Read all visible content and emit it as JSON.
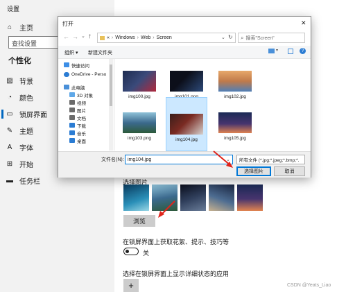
{
  "settings": {
    "window_title": "设置",
    "home_label": "主页",
    "search_placeholder": "查找设置",
    "section_title": "个性化",
    "nav": [
      {
        "label": "背景",
        "icon": "picture-icon"
      },
      {
        "label": "颜色",
        "icon": "palette-icon"
      },
      {
        "label": "锁屏界面",
        "icon": "lockscreen-icon",
        "active": true
      },
      {
        "label": "主题",
        "icon": "theme-icon"
      },
      {
        "label": "字体",
        "icon": "font-icon"
      },
      {
        "label": "开始",
        "icon": "start-icon"
      },
      {
        "label": "任务栏",
        "icon": "taskbar-icon"
      }
    ],
    "choose_picture_label": "选择图片",
    "browse_button": "浏览",
    "tips_label": "在锁屏界面上获取花絮、提示、技巧等",
    "toggle_state": "关",
    "detail_app_label": "选择在锁屏界面上显示详细状态的应用",
    "add_symbol": "+"
  },
  "dialog": {
    "title": "打开",
    "breadcrumb": [
      "«",
      "Windows",
      "Web",
      "Screen"
    ],
    "search_placeholder": "搜索\"Screen\"",
    "organize_label": "组织 ▾",
    "new_folder_label": "新建文件夹",
    "tree": [
      {
        "label": "快速访问",
        "color": "#3d8ee6"
      },
      {
        "label": "OneDrive - Perso",
        "color": "#2b7cd3"
      },
      {
        "label": "此电脑",
        "color": "#4a90d9"
      },
      {
        "label": "3D 对象",
        "color": "#5fa8e8"
      },
      {
        "label": "视频",
        "color": "#6b6b6b"
      },
      {
        "label": "图片",
        "color": "#6b6b6b"
      },
      {
        "label": "文档",
        "color": "#6b6b6b"
      },
      {
        "label": "下载",
        "color": "#2b7cd3"
      },
      {
        "label": "音乐",
        "color": "#2b7cd3"
      },
      {
        "label": "桌面",
        "color": "#2b7cd3"
      }
    ],
    "files": [
      {
        "name": "img100.jpg",
        "c1": "#1d2b4f",
        "c2": "#b0283c"
      },
      {
        "name": "img101.png",
        "c1": "#0c0f1a",
        "c2": "#2d4a7a"
      },
      {
        "name": "img102.jpg",
        "c1": "#e7a86b",
        "c2": "#4f7fb7"
      },
      {
        "name": "img103.png",
        "c1": "#3c6a8e",
        "c2": "#2d5a3a"
      },
      {
        "name": "img104.jpg",
        "c1": "#3a1e1a",
        "c2": "#d6d2cf"
      },
      {
        "name": "img105.jpg",
        "c1": "#1b2a55",
        "c2": "#e08350"
      }
    ],
    "filename_label": "文件名(N):",
    "filename_value": "img104.jpg",
    "filetype_value": "所有文件 (*.jpg;*.jpeg;*.bmp;*.",
    "open_button": "选择图片",
    "cancel_button": "取消"
  },
  "watermark": "CSDN @Yeats_Liao"
}
